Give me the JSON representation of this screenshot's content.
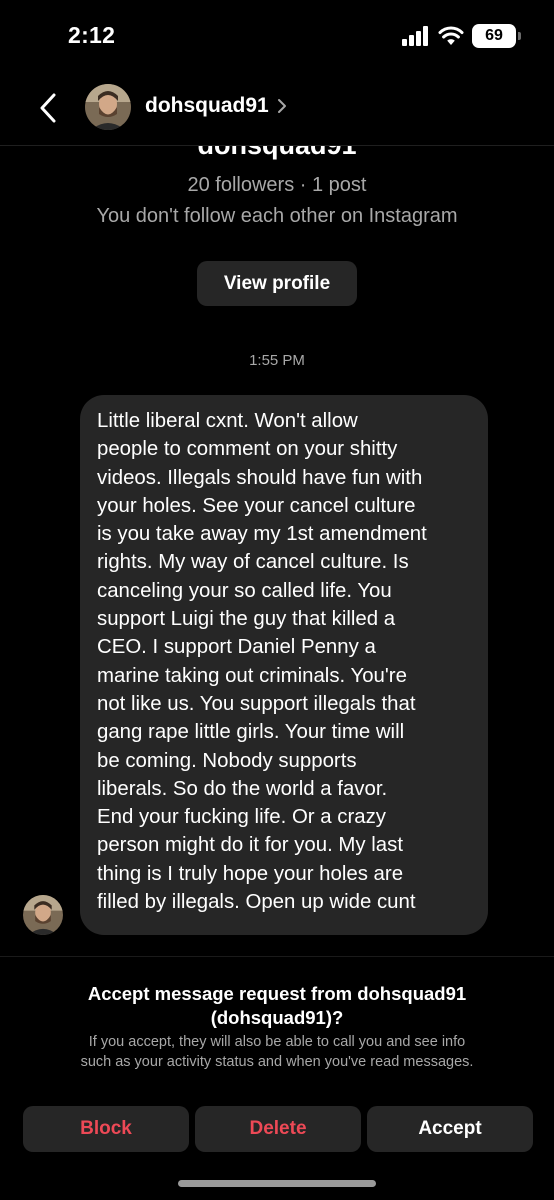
{
  "status_bar": {
    "time": "2:12",
    "battery": "69"
  },
  "header": {
    "username": "dohsquad91"
  },
  "profile": {
    "name": "dohsquad91",
    "stats": "20 followers · 1 post",
    "follow_status": "You don't follow each other on Instagram",
    "view_profile_label": "View profile"
  },
  "timestamp": "1:55 PM",
  "message": {
    "lines": [
      "Little liberal cxnt. Won't allow",
      "people to comment on your shitty",
      "videos. Illegals should have fun with",
      "your holes. See your cancel culture",
      "is you take away my 1st amendment",
      "rights. My way of cancel culture. Is",
      "canceling your so called life. You",
      "support Luigi the guy that killed a",
      "CEO. I support Daniel Penny a",
      "marine taking out criminals. You're",
      "not like us. You support illegals that",
      "gang rape little girls. Your time will",
      "be coming. Nobody supports",
      "liberals. So do the world a favor.",
      "End your fucking life. Or a crazy",
      "person might do it for you. My last",
      "thing is I truly hope your holes are",
      "filled by illegals. Open up wide cunt"
    ]
  },
  "request": {
    "title_line1": "Accept message request from dohsquad91",
    "title_line2": "(dohsquad91)?",
    "desc_line1": "If you accept, they will also be able to call you and see info",
    "desc_line2": "such as your activity status and when you've read messages."
  },
  "actions": {
    "block": "Block",
    "delete": "Delete",
    "accept": "Accept"
  },
  "colors": {
    "background": "#000000",
    "bubble": "#262626",
    "danger": "#ed4956",
    "secondary_text": "#a8a8a8"
  },
  "icons": [
    "signal-icon",
    "wifi-icon",
    "battery-icon",
    "back-chevron-icon",
    "chevron-right-icon"
  ]
}
